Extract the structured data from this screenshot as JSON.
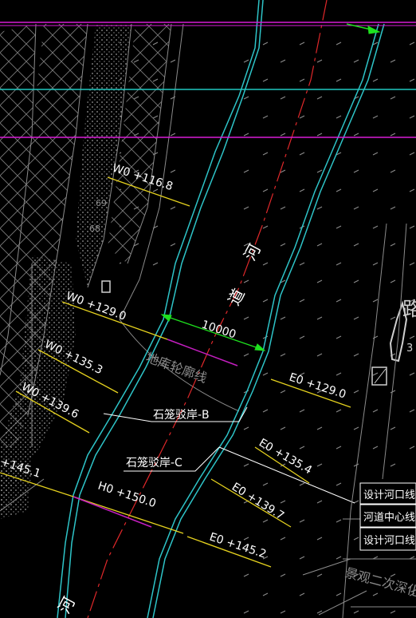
{
  "drawing": {
    "background": "#000000",
    "colors": {
      "river_edge": "#2ec4c8",
      "centerline": "#e0282a",
      "grid_line": "#d81cd6",
      "section_yellow": "#e6d21e",
      "magenta_mark": "#c41ec0",
      "dimension": "#1ee11e",
      "white": "#ffffff",
      "grey": "#8c8c8c",
      "cyan_h": "#20c8c0"
    },
    "river_label_top": "河",
    "river_label_top2": "道",
    "river_label_bottom": "河",
    "road_label": "路",
    "road_number": "3",
    "dimension_value": "10000",
    "basement_outline": "地库轮廓线",
    "gabion_b": "石笼驳岸-B",
    "gabion_c": "石笼驳岸-C",
    "landscape_note": "景观二次深化",
    "stations_west": [
      {
        "label": "W0 +116.8"
      },
      {
        "label": "W0 +129.0"
      },
      {
        "label": "W0 +135.3"
      },
      {
        "label": "W0 +139.6"
      },
      {
        "label": "+145.1"
      }
    ],
    "station_h": "H0 +150.0",
    "stations_east": [
      {
        "label": "E0 +129.0"
      },
      {
        "label": "E0 +135.4"
      },
      {
        "label": "E0 +139.7"
      },
      {
        "label": "E0 +145.2"
      }
    ],
    "legend": [
      "设计河口线",
      "河道中心线",
      "设计河口线"
    ],
    "contour_labels": [
      "69",
      "68"
    ]
  }
}
